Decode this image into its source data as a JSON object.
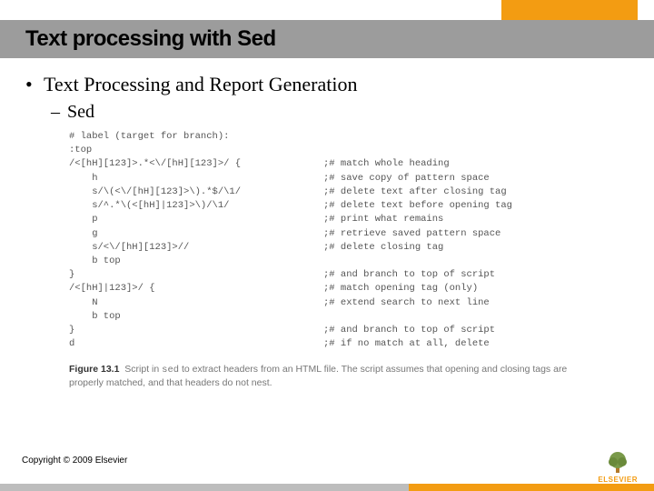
{
  "header": {
    "title": "Text processing with Sed"
  },
  "bullets": {
    "main": "Text Processing and Report Generation",
    "sub": "Sed"
  },
  "code": [
    {
      "left": "# label (target for branch):",
      "right": ""
    },
    {
      "left": ":top",
      "right": ""
    },
    {
      "left": "/<[hH][123]>.*<\\/[hH][123]>/ {",
      "right": ";# match whole heading"
    },
    {
      "left": "    h",
      "right": ";# save copy of pattern space"
    },
    {
      "left": "    s/\\(<\\/[hH][123]>\\).*$/\\1/",
      "right": ";# delete text after closing tag"
    },
    {
      "left": "    s/^.*\\(<[hH]|123]>\\)/\\1/",
      "right": ";# delete text before opening tag"
    },
    {
      "left": "    p",
      "right": ";# print what remains"
    },
    {
      "left": "    g",
      "right": ";# retrieve saved pattern space"
    },
    {
      "left": "    s/<\\/[hH][123]>//",
      "right": ";# delete closing tag"
    },
    {
      "left": "    b top",
      "right": ""
    },
    {
      "left": "}",
      "right": ";# and branch to top of script"
    },
    {
      "left": "/<[hH]|123]>/ {",
      "right": ";# match opening tag (only)"
    },
    {
      "left": "    N",
      "right": ";# extend search to next line"
    },
    {
      "left": "    b top",
      "right": ""
    },
    {
      "left": "}",
      "right": ";# and branch to top of script"
    },
    {
      "left": "d",
      "right": ";# if no match at all, delete"
    }
  ],
  "caption": {
    "fig": "Figure 13.1",
    "lead": "Script in ",
    "tool": "sed",
    "rest": " to extract headers from an HTML file. The script assumes that opening and closing tags are properly matched, and that headers do not nest."
  },
  "footer": {
    "copyright": "Copyright © 2009 Elsevier",
    "publisher": "ELSEVIER"
  }
}
